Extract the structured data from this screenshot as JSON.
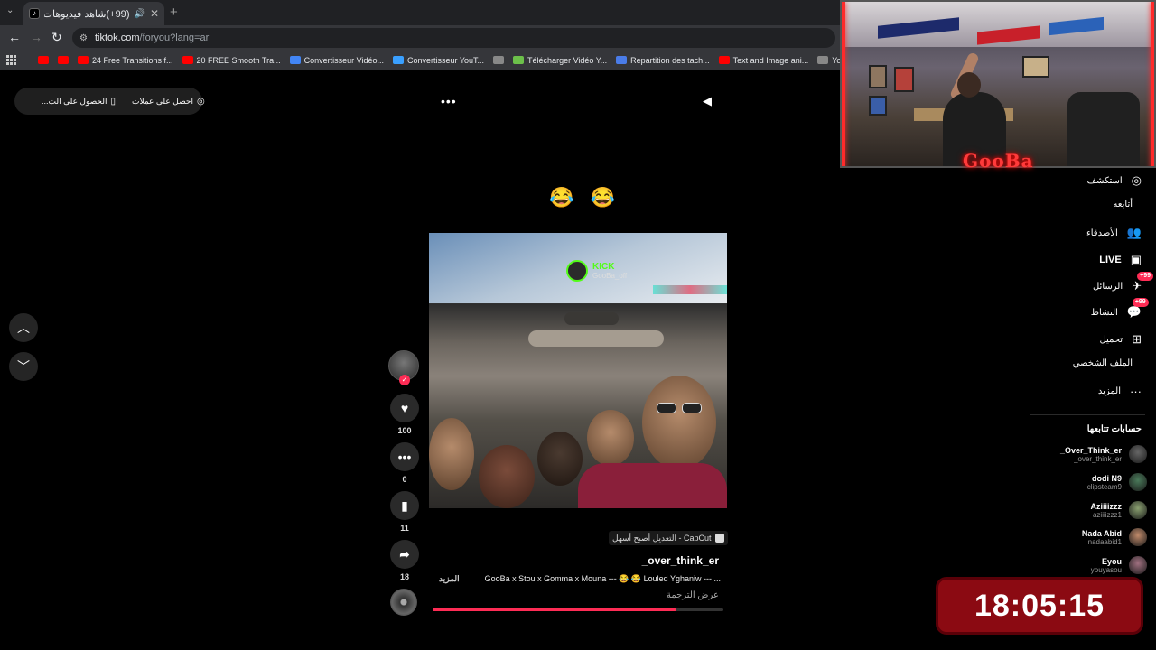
{
  "browser": {
    "tab_title": "(99+)شاهد فيديوهات متصدر",
    "favicon_label": "♪",
    "url_host": "tiktok.com",
    "url_path": "/foryou?lang=ar",
    "bookmarks": [
      {
        "label": "",
        "color": "#ff0000"
      },
      {
        "label": "",
        "color": "#ff0000"
      },
      {
        "label": "24 Free Transitions f...",
        "color": "#ff0000"
      },
      {
        "label": "20 FREE Smooth Tra...",
        "color": "#ff0000"
      },
      {
        "label": "Convertisseur Vidéo...",
        "color": "#4285f4"
      },
      {
        "label": "Convertisseur YouT...",
        "color": "#3aa0ff"
      },
      {
        "label": "",
        "color": "#888888"
      },
      {
        "label": "Télécharger Vidéo Y...",
        "color": "#6cc04a"
      },
      {
        "label": "Repartition des tach...",
        "color": "#4a7ce8"
      },
      {
        "label": "Text and Image ani...",
        "color": "#ff0000"
      },
      {
        "label": "YouTube Converter...",
        "color": "#888888"
      }
    ]
  },
  "topbar": {
    "get_coins": "احصل على عملات",
    "get_app": "الحصول على الت..."
  },
  "post": {
    "emojis": "😂 😂",
    "overlay_brand": "KICK",
    "overlay_handle": "GooBa_off",
    "capcut_label": "CapCut - التعديل أصبح أسهل",
    "author": "_over_think_er",
    "description": "GooBa x Stou x Gomma x Mouna --- 😂 😂 Louled Yghaniw --- ...",
    "more": "المزيد",
    "see_translation": "عرض الترجمة",
    "progress": 0.84
  },
  "actions": {
    "likes": "100",
    "comments": "0",
    "saves": "11",
    "shares": "18"
  },
  "sidebar": {
    "nav": [
      {
        "label": "استكشف",
        "icon": "compass-icon",
        "glyph": "◎",
        "badge": ""
      },
      {
        "label": "أتابعه",
        "icon": "avatar",
        "glyph": "",
        "badge": ""
      },
      {
        "label": "الأصدقاء",
        "icon": "friends-icon",
        "glyph": "👥",
        "badge": ""
      },
      {
        "label": "LIVE",
        "icon": "live-icon",
        "glyph": "▣",
        "badge": ""
      },
      {
        "label": "الرسائل",
        "icon": "messages-icon",
        "glyph": "✈",
        "badge": "99+"
      },
      {
        "label": "النشاط",
        "icon": "activity-icon",
        "glyph": "💬",
        "badge": "99+"
      },
      {
        "label": "تحميل",
        "icon": "upload-icon",
        "glyph": "⊞",
        "badge": ""
      },
      {
        "label": "الملف الشخصي",
        "icon": "avatar",
        "glyph": "",
        "badge": ""
      },
      {
        "label": "المزيد",
        "icon": "more-icon",
        "glyph": "···",
        "badge": ""
      }
    ],
    "following_title": "حسابات تتابعها",
    "following": [
      {
        "name": "_Over_Think_er",
        "handle": "_over_think_er",
        "color": "#666666"
      },
      {
        "name": "dodi N9",
        "handle": "clipsteam9",
        "color": "#4a7a5a"
      },
      {
        "name": "Aziiiizzz",
        "handle": "aziiiizzz1",
        "color": "#8aa070"
      },
      {
        "name": "Nada Abid",
        "handle": "nadaabid1",
        "color": "#c08a6a"
      },
      {
        "name": "Eyou",
        "handle": "youyasou",
        "color": "#a07080"
      }
    ]
  },
  "overlay": {
    "streamer_logo": "GooBa",
    "clock": "18:05:15"
  }
}
